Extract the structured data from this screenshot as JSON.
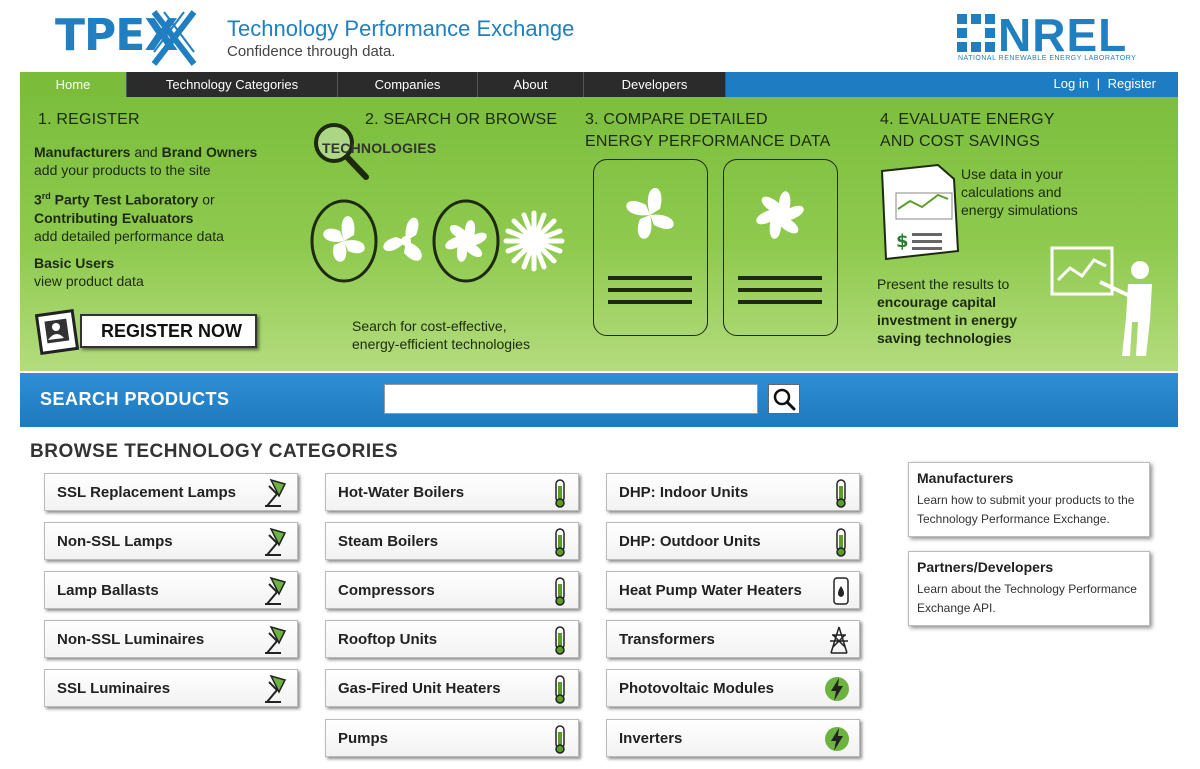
{
  "header": {
    "logo_text": "TPEX",
    "site_title": "Technology Performance Exchange",
    "tagline": "Confidence through data.",
    "partner_logo": "NREL",
    "partner_sub": "NATIONAL RENEWABLE ENERGY LABORATORY"
  },
  "nav": {
    "items": [
      {
        "label": "Home",
        "active": true
      },
      {
        "label": "Technology Categories",
        "active": false
      },
      {
        "label": "Companies",
        "active": false
      },
      {
        "label": "About",
        "active": false
      },
      {
        "label": "Developers",
        "active": false
      }
    ],
    "login": "Log in",
    "separator": "|",
    "register": "Register"
  },
  "hero": {
    "step1": {
      "title": "1. REGISTER",
      "p1_bold1": "Manufacturers",
      "p1_mid": " and ",
      "p1_bold2": "Brand Owners",
      "p1_rest": "add your products to the site",
      "p2_bold1": "3",
      "p2_sup": "rd",
      "p2_bold1b": " Party Test Laboratory",
      "p2_mid": " or",
      "p2_bold2": "Contributing Evaluators",
      "p2_rest": "add detailed performance data",
      "p3_bold": "Basic Users",
      "p3_rest": "view product data",
      "button": "REGISTER NOW"
    },
    "step2": {
      "title": "2. SEARCH OR BROWSE",
      "magnify_text": "TECHNOLOGIES",
      "caption_l1": "Search for cost-effective,",
      "caption_l2": "energy-efficient technologies"
    },
    "step3": {
      "title_l1": "3. COMPARE DETAILED",
      "title_l2": "ENERGY PERFORMANCE DATA"
    },
    "step4": {
      "title_l1": "4. EVALUATE ENERGY",
      "title_l2": "AND COST SAVINGS",
      "use_l1": "Use data in your",
      "use_l2": "calculations and",
      "use_l3": "energy simulations",
      "present": "Present the results to",
      "bold_l1": "encourage capital",
      "bold_l2": "investment in energy",
      "bold_l3": "saving technologies"
    }
  },
  "search": {
    "label": "SEARCH PRODUCTS",
    "value": "",
    "icon": "magnifier-icon"
  },
  "browse": {
    "title": "BROWSE TECHNOLOGY CATEGORIES",
    "columns": [
      [
        {
          "label": "SSL Replacement Lamps",
          "icon": "lamp-icon"
        },
        {
          "label": "Non-SSL Lamps",
          "icon": "lamp-icon"
        },
        {
          "label": "Lamp Ballasts",
          "icon": "lamp-icon"
        },
        {
          "label": "Non-SSL Luminaires",
          "icon": "lamp-icon"
        },
        {
          "label": "SSL Luminaires",
          "icon": "lamp-icon"
        }
      ],
      [
        {
          "label": "Hot-Water Boilers",
          "icon": "thermometer-icon"
        },
        {
          "label": "Steam Boilers",
          "icon": "thermometer-icon"
        },
        {
          "label": "Compressors",
          "icon": "thermometer-icon"
        },
        {
          "label": "Rooftop Units",
          "icon": "thermometer-icon"
        },
        {
          "label": "Gas-Fired Unit Heaters",
          "icon": "thermometer-icon"
        },
        {
          "label": "Pumps",
          "icon": "thermometer-icon"
        }
      ],
      [
        {
          "label": "DHP: Indoor Units",
          "icon": "thermometer-icon"
        },
        {
          "label": "DHP: Outdoor Units",
          "icon": "thermometer-icon"
        },
        {
          "label": "Heat Pump Water Heaters",
          "icon": "water-heater-icon"
        },
        {
          "label": "Transformers",
          "icon": "power-tower-icon"
        },
        {
          "label": "Photovoltaic Modules",
          "icon": "lightning-icon"
        },
        {
          "label": "Inverters",
          "icon": "lightning-icon"
        }
      ]
    ]
  },
  "sidebar": {
    "boxes": [
      {
        "title": "Manufacturers",
        "text_l1": "Learn how to submit your products to the",
        "text_l2": "Technology Performance Exchange."
      },
      {
        "title": "Partners/Developers",
        "text_l1": "Learn about the Technology Performance",
        "text_l2": "Exchange API."
      }
    ]
  },
  "colors": {
    "brand_blue": "#1f7fc0",
    "nav_dark": "#2b2b2b",
    "green": "#7bbd3a",
    "icon_green": "#5a9e2a"
  }
}
